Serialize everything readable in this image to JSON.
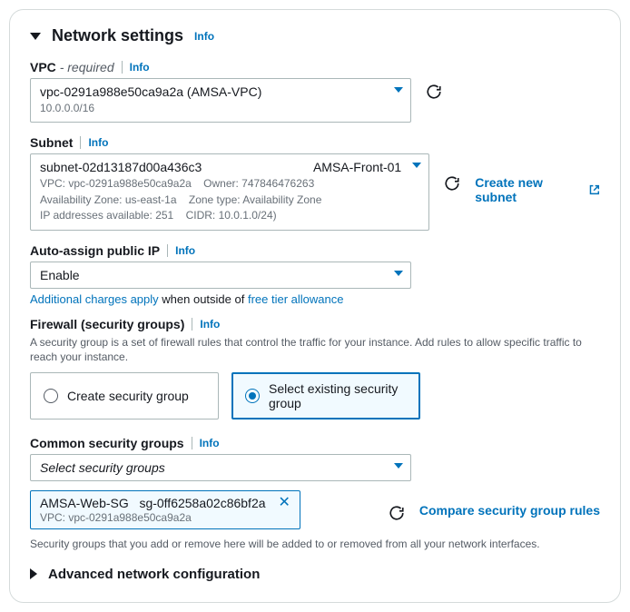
{
  "header": {
    "title": "Network settings",
    "info": "Info"
  },
  "vpc": {
    "label": "VPC",
    "required": "- required",
    "info": "Info",
    "value": "vpc-0291a988e50ca9a2a (AMSA-VPC)",
    "cidr": "10.0.0.0/16"
  },
  "subnet": {
    "label": "Subnet",
    "info": "Info",
    "id": "subnet-02d13187d00a436c3",
    "name": "AMSA-Front-01",
    "vpc_line": "VPC: vpc-0291a988e50ca9a2a",
    "owner_line": "Owner: 747846476263",
    "az_line": "Availability Zone: us-east-1a",
    "zonetype_line": "Zone type: Availability Zone",
    "ip_line": "IP addresses available: 251",
    "cidr_line": "CIDR: 10.0.1.0/24)",
    "create_link": "Create new subnet"
  },
  "autoip": {
    "label": "Auto-assign public IP",
    "info": "Info",
    "value": "Enable",
    "charges_a": "Additional charges apply",
    "charges_mid": " when outside of ",
    "charges_b": "free tier allowance"
  },
  "firewall": {
    "label": "Firewall (security groups)",
    "info": "Info",
    "desc": "A security group is a set of firewall rules that control the traffic for your instance. Add rules to allow specific traffic to reach your instance.",
    "opt_create": "Create security group",
    "opt_existing": "Select existing security group"
  },
  "sg": {
    "label": "Common security groups",
    "info": "Info",
    "placeholder": "Select security groups",
    "compare": "Compare security group rules",
    "token_name": "AMSA-Web-SG",
    "token_id": "sg-0ff6258a02c86bf2a",
    "token_vpc": "VPC: vpc-0291a988e50ca9a2a",
    "footer": "Security groups that you add or remove here will be added to or removed from all your network interfaces."
  },
  "advanced": {
    "title": "Advanced network configuration"
  }
}
